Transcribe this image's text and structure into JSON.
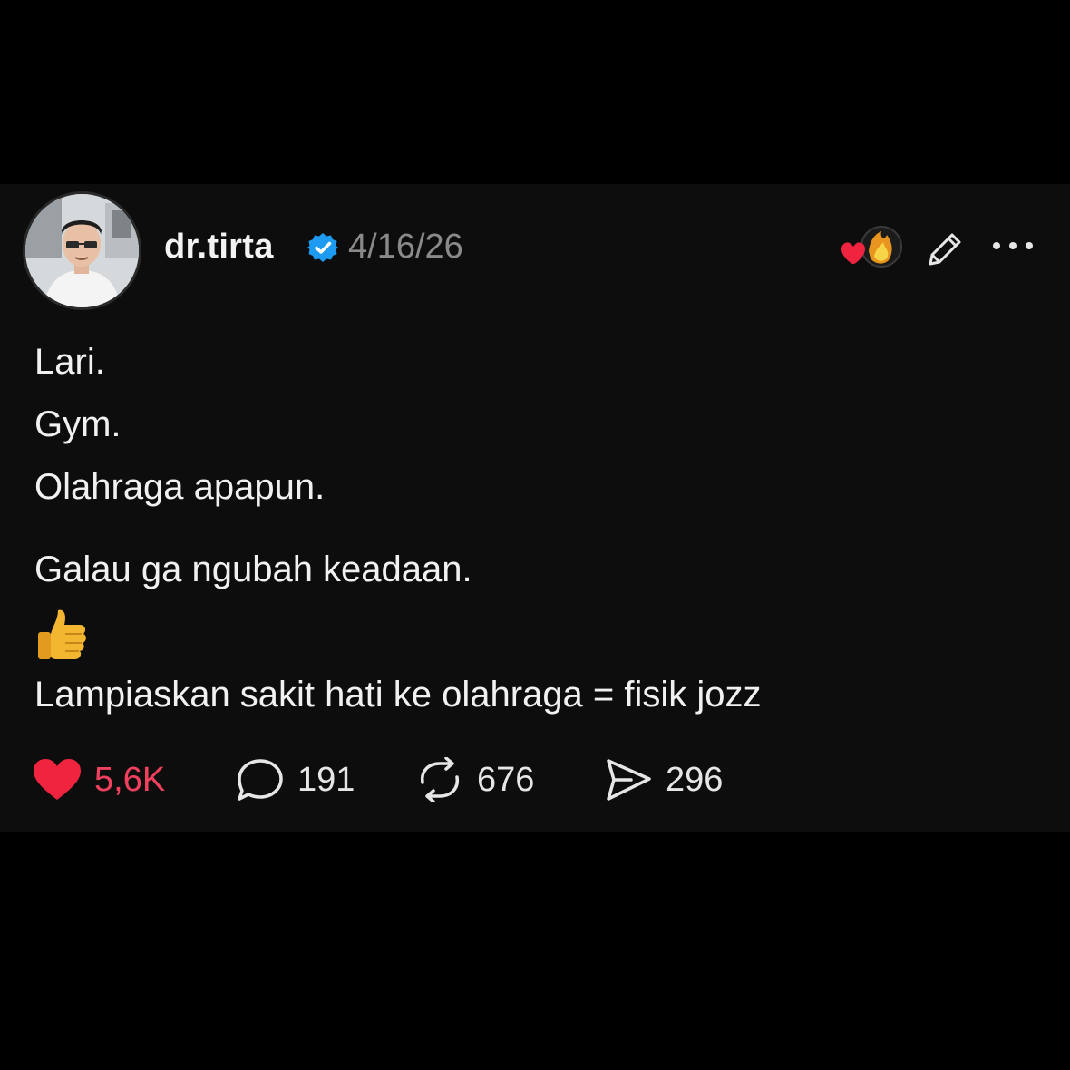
{
  "post": {
    "author": {
      "username": "dr.tirta",
      "verified": true
    },
    "date": "4/16/26",
    "header_icons": [
      "heart-reaction-icon",
      "edit-pencil-icon",
      "more-dots-icon"
    ],
    "text": {
      "line1": "Lari.",
      "line2": "Gym.",
      "line3": "Olahraga apapun.",
      "line4": "Galau ga ngubah keadaan.",
      "emoji": "thumbs-up-emoji",
      "line5": "Lampiaskan sakit hati ke olahraga = fisik jozz"
    },
    "actions": {
      "likes": "5,6K",
      "replies": "191",
      "reposts": "676",
      "shares": "296"
    }
  },
  "colors": {
    "background": "#000000",
    "card": "#0d0d0d",
    "text": "#f1f1f1",
    "muted": "#8a8a8a",
    "like": "#f0405e",
    "verified": "#1d9bf0"
  }
}
